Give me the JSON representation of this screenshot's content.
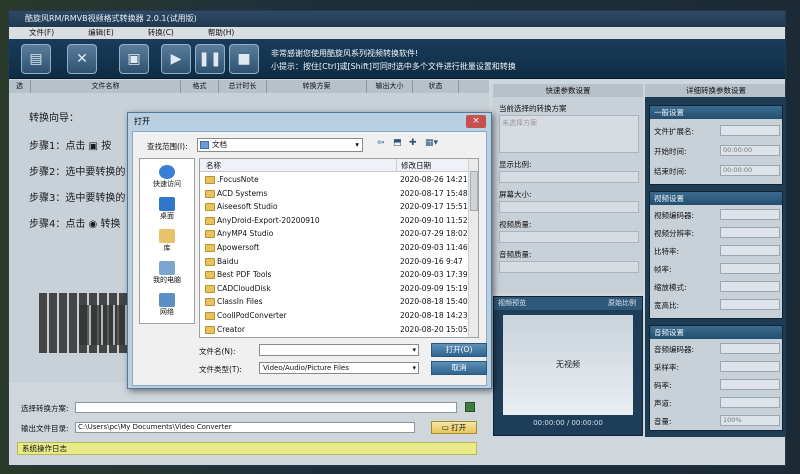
{
  "window": {
    "title": "酷旋风RM/RMVB视频格式转换器 2.0.1(试用版)"
  },
  "menu": [
    "文件(F)",
    "编辑(E)",
    "转换(C)",
    "帮助(H)"
  ],
  "toolbar": {
    "notice_title": "非常感谢您使用酷旋风系列视频转换软件!",
    "notice_tip": "小提示：按住[Ctrl]或[Shift]可同时选中多个文件进行批量设置和转换"
  },
  "columns": [
    "选",
    "文件名称",
    "格式",
    "总计时长",
    "转换方案",
    "输出大小",
    "状态"
  ],
  "guide": {
    "title": "转换向导：",
    "step1": "步骤1：点击",
    "step1b": "按",
    "step2": "步骤2：选中要转换的",
    "step3": "步骤3：选中要转换的",
    "step4": "步骤4：点击",
    "step4b": "转换"
  },
  "quick": {
    "header": "快速参数设置",
    "scheme_label": "当前选择的转换方案",
    "scheme_placeholder": "未选择方案",
    "ratio_label": "显示比例:",
    "screen_label": "屏幕大小:",
    "vq_label": "视频质量:",
    "aq_label": "音频质量:"
  },
  "preview": {
    "header": "视频预览",
    "ratio": "原始比例",
    "screen": "无视频",
    "time": "00:00:00 / 00:00:00"
  },
  "detail": {
    "header": "详细转换参数设置",
    "general": {
      "title": "一般设置",
      "ext": "文件扩展名:",
      "start": "开始时间:",
      "end": "结束时间:",
      "start_val": "00:00:00",
      "end_val": "00:00:00"
    },
    "video": {
      "title": "视频设置",
      "rows": [
        "视频编码器:",
        "视频分辨率:",
        "比特率:",
        "帧率:",
        "缩放模式:",
        "宽高比:"
      ]
    },
    "audio": {
      "title": "音频设置",
      "rows": [
        "音频编码器:",
        "采样率:",
        "码率:",
        "声道:",
        "音量:"
      ],
      "volume": "100%"
    }
  },
  "bottom": {
    "scheme_label": "选择转换方案:",
    "output_label": "输出文件目录:",
    "output_path": "C:\\Users\\pc\\My Documents\\Video Converter",
    "open": "打开",
    "log": "系统操作日志"
  },
  "dialog": {
    "title": "打开",
    "close": "×",
    "lookin_label": "查找范围(I):",
    "lookin_value": "文档",
    "places": [
      "快速访问",
      "桌面",
      "库",
      "我的电脑",
      "网络"
    ],
    "headers": {
      "name": "名称",
      "date": "修改日期"
    },
    "files": [
      {
        "name": ".FocusNote",
        "date": "2020-08-26 14:21"
      },
      {
        "name": "ACD Systems",
        "date": "2020-08-17 15:48"
      },
      {
        "name": "Aiseesoft Studio",
        "date": "2020-09-17 15:51"
      },
      {
        "name": "AnyDroid-Export-20200910",
        "date": "2020-09-10 11:52"
      },
      {
        "name": "AnyMP4 Studio",
        "date": "2020-07-29 18:02"
      },
      {
        "name": "Apowersoft",
        "date": "2020-09-03 11:46"
      },
      {
        "name": "Baidu",
        "date": "2020-09-16 9:47"
      },
      {
        "name": "Best PDF Tools",
        "date": "2020-09-03 17:39"
      },
      {
        "name": "CADCloudDisk",
        "date": "2020-09-09 15:19"
      },
      {
        "name": "ClassIn Files",
        "date": "2020-08-18 15:40"
      },
      {
        "name": "CoolIPodConverter",
        "date": "2020-08-18 14:23"
      },
      {
        "name": "Creator",
        "date": "2020-08-20 15:05"
      }
    ],
    "filename_label": "文件名(N):",
    "filetype_label": "文件类型(T):",
    "filetype_value": "Video/Audio/Picture Files",
    "open_btn": "打开(O)",
    "cancel_btn": "取消"
  }
}
